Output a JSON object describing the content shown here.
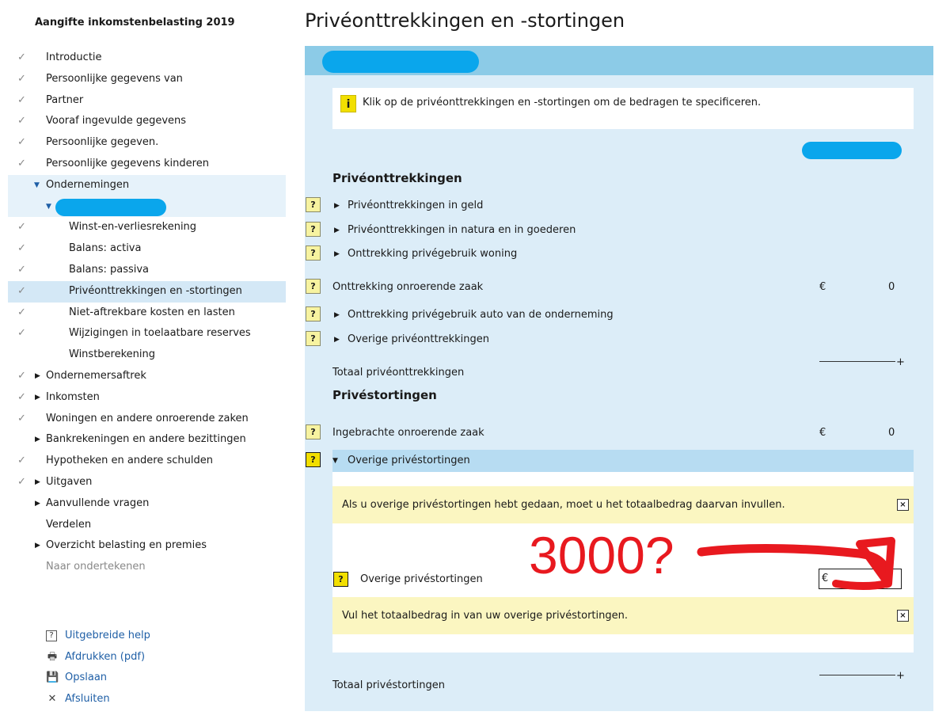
{
  "sidebar": {
    "title": "Aangifte inkomstenbelasting 2019",
    "items": [
      {
        "label": "Introductie",
        "check": "✓"
      },
      {
        "label": "Persoonlijke gegevens van",
        "check": "✓"
      },
      {
        "label": "Partner",
        "check": "✓"
      },
      {
        "label": "Vooraf ingevulde gegevens",
        "check": "✓"
      },
      {
        "label": "Persoonlijke gegeven.",
        "check": "✓"
      },
      {
        "label": "Persoonlijke gegevens kinderen",
        "check": "✓"
      },
      {
        "label": "Ondernemingen",
        "check": ""
      },
      {
        "label": "",
        "check": ""
      },
      {
        "label": "Winst-en-verliesrekening",
        "check": "✓"
      },
      {
        "label": "Balans: activa",
        "check": "✓"
      },
      {
        "label": "Balans: passiva",
        "check": "✓"
      },
      {
        "label": "Privéonttrekkingen en -stortingen",
        "check": "✓"
      },
      {
        "label": "Niet-aftrekbare kosten en lasten",
        "check": "✓"
      },
      {
        "label": "Wijzigingen in toelaatbare reserves",
        "check": "✓"
      },
      {
        "label": "Winstberekening",
        "check": ""
      },
      {
        "label": "Ondernemersaftrek",
        "check": "✓"
      },
      {
        "label": "Inkomsten",
        "check": "✓"
      },
      {
        "label": "Woningen en andere onroerende zaken",
        "check": "✓"
      },
      {
        "label": "Bankrekeningen en andere bezittingen",
        "check": ""
      },
      {
        "label": "Hypotheken en andere schulden",
        "check": "✓"
      },
      {
        "label": "Uitgaven",
        "check": "✓"
      },
      {
        "label": "Aanvullende vragen",
        "check": ""
      },
      {
        "label": "Verdelen",
        "check": ""
      },
      {
        "label": "Overzicht belasting en premies",
        "check": ""
      },
      {
        "label": "Naar ondertekenen",
        "check": ""
      }
    ],
    "tools": [
      {
        "label": "Uitgebreide help",
        "icon": "?"
      },
      {
        "label": "Afdrukken (pdf)",
        "icon": "🖶"
      },
      {
        "label": "Opslaan",
        "icon": "💾"
      },
      {
        "label": "Afsluiten",
        "icon": "✕"
      }
    ]
  },
  "main": {
    "title": "Privéonttrekkingen en -stortingen",
    "info_icon": "i",
    "info_text": "Klik op de privéonttrekkingen en -stortingen om de bedragen te specificeren.",
    "help_glyph": "?",
    "close_glyph": "×",
    "section1": {
      "heading": "Privéonttrekkingen",
      "rows": [
        {
          "label": "Privéonttrekkingen in geld"
        },
        {
          "label": "Privéonttrekkingen in natura en in goederen"
        },
        {
          "label": "Onttrekking privégebruik woning"
        },
        {
          "label": "Onttrekking onroerende zaak",
          "currency": "€",
          "value": "0"
        },
        {
          "label": "Onttrekking privégebruik auto van de onderneming"
        },
        {
          "label": "Overige privéonttrekkingen"
        }
      ],
      "total_label": "Totaal privéonttrekkingen",
      "plus": "+"
    },
    "section2": {
      "heading": "Privéstortingen",
      "row_property": {
        "label": "Ingebrachte onroerende zaak",
        "currency": "€",
        "value": "0"
      },
      "expanded": {
        "label": "Overige privéstortingen",
        "note1": "Als u overige privéstortingen hebt gedaan, moet u het totaalbedrag daarvan invullen.",
        "field_label": "Overige privéstortingen",
        "field_currency": "€",
        "field_value": "",
        "note2": "Vul het totaalbedrag in van uw overige privéstortingen."
      },
      "total_label": "Totaal privéstortingen",
      "plus": "+"
    }
  },
  "annotation": {
    "text": "3000?",
    "color": "#e8191f"
  }
}
